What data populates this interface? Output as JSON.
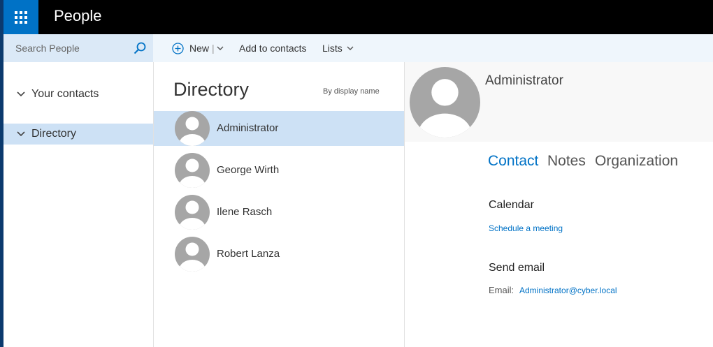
{
  "app": {
    "title": "People"
  },
  "search": {
    "placeholder": "Search People"
  },
  "commands": {
    "new_label": "New",
    "add_label": "Add to contacts",
    "lists_label": "Lists"
  },
  "sidebar": {
    "items": [
      {
        "label": "Your contacts"
      },
      {
        "label": "Directory",
        "selected": true
      }
    ]
  },
  "list": {
    "title": "Directory",
    "sort_label": "By display name",
    "people": [
      {
        "name": "Administrator",
        "selected": true
      },
      {
        "name": "George Wirth"
      },
      {
        "name": "Ilene Rasch"
      },
      {
        "name": "Robert Lanza"
      }
    ]
  },
  "detail": {
    "name": "Administrator",
    "tabs": [
      {
        "label": "Contact",
        "active": true
      },
      {
        "label": "Notes"
      },
      {
        "label": "Organization"
      }
    ],
    "calendar": {
      "title": "Calendar",
      "link": "Schedule a meeting"
    },
    "email": {
      "title": "Send email",
      "label": "Email:",
      "address": "Administrator@cyber.local"
    }
  },
  "colors": {
    "accent": "#0072c6",
    "selection": "#cde1f5",
    "topbar": "#000000",
    "command_bar": "#eff6fc"
  },
  "icons": [
    "app-launcher-icon",
    "search-icon",
    "plus-circle-icon",
    "chevron-down-icon",
    "avatar-placeholder-icon"
  ]
}
